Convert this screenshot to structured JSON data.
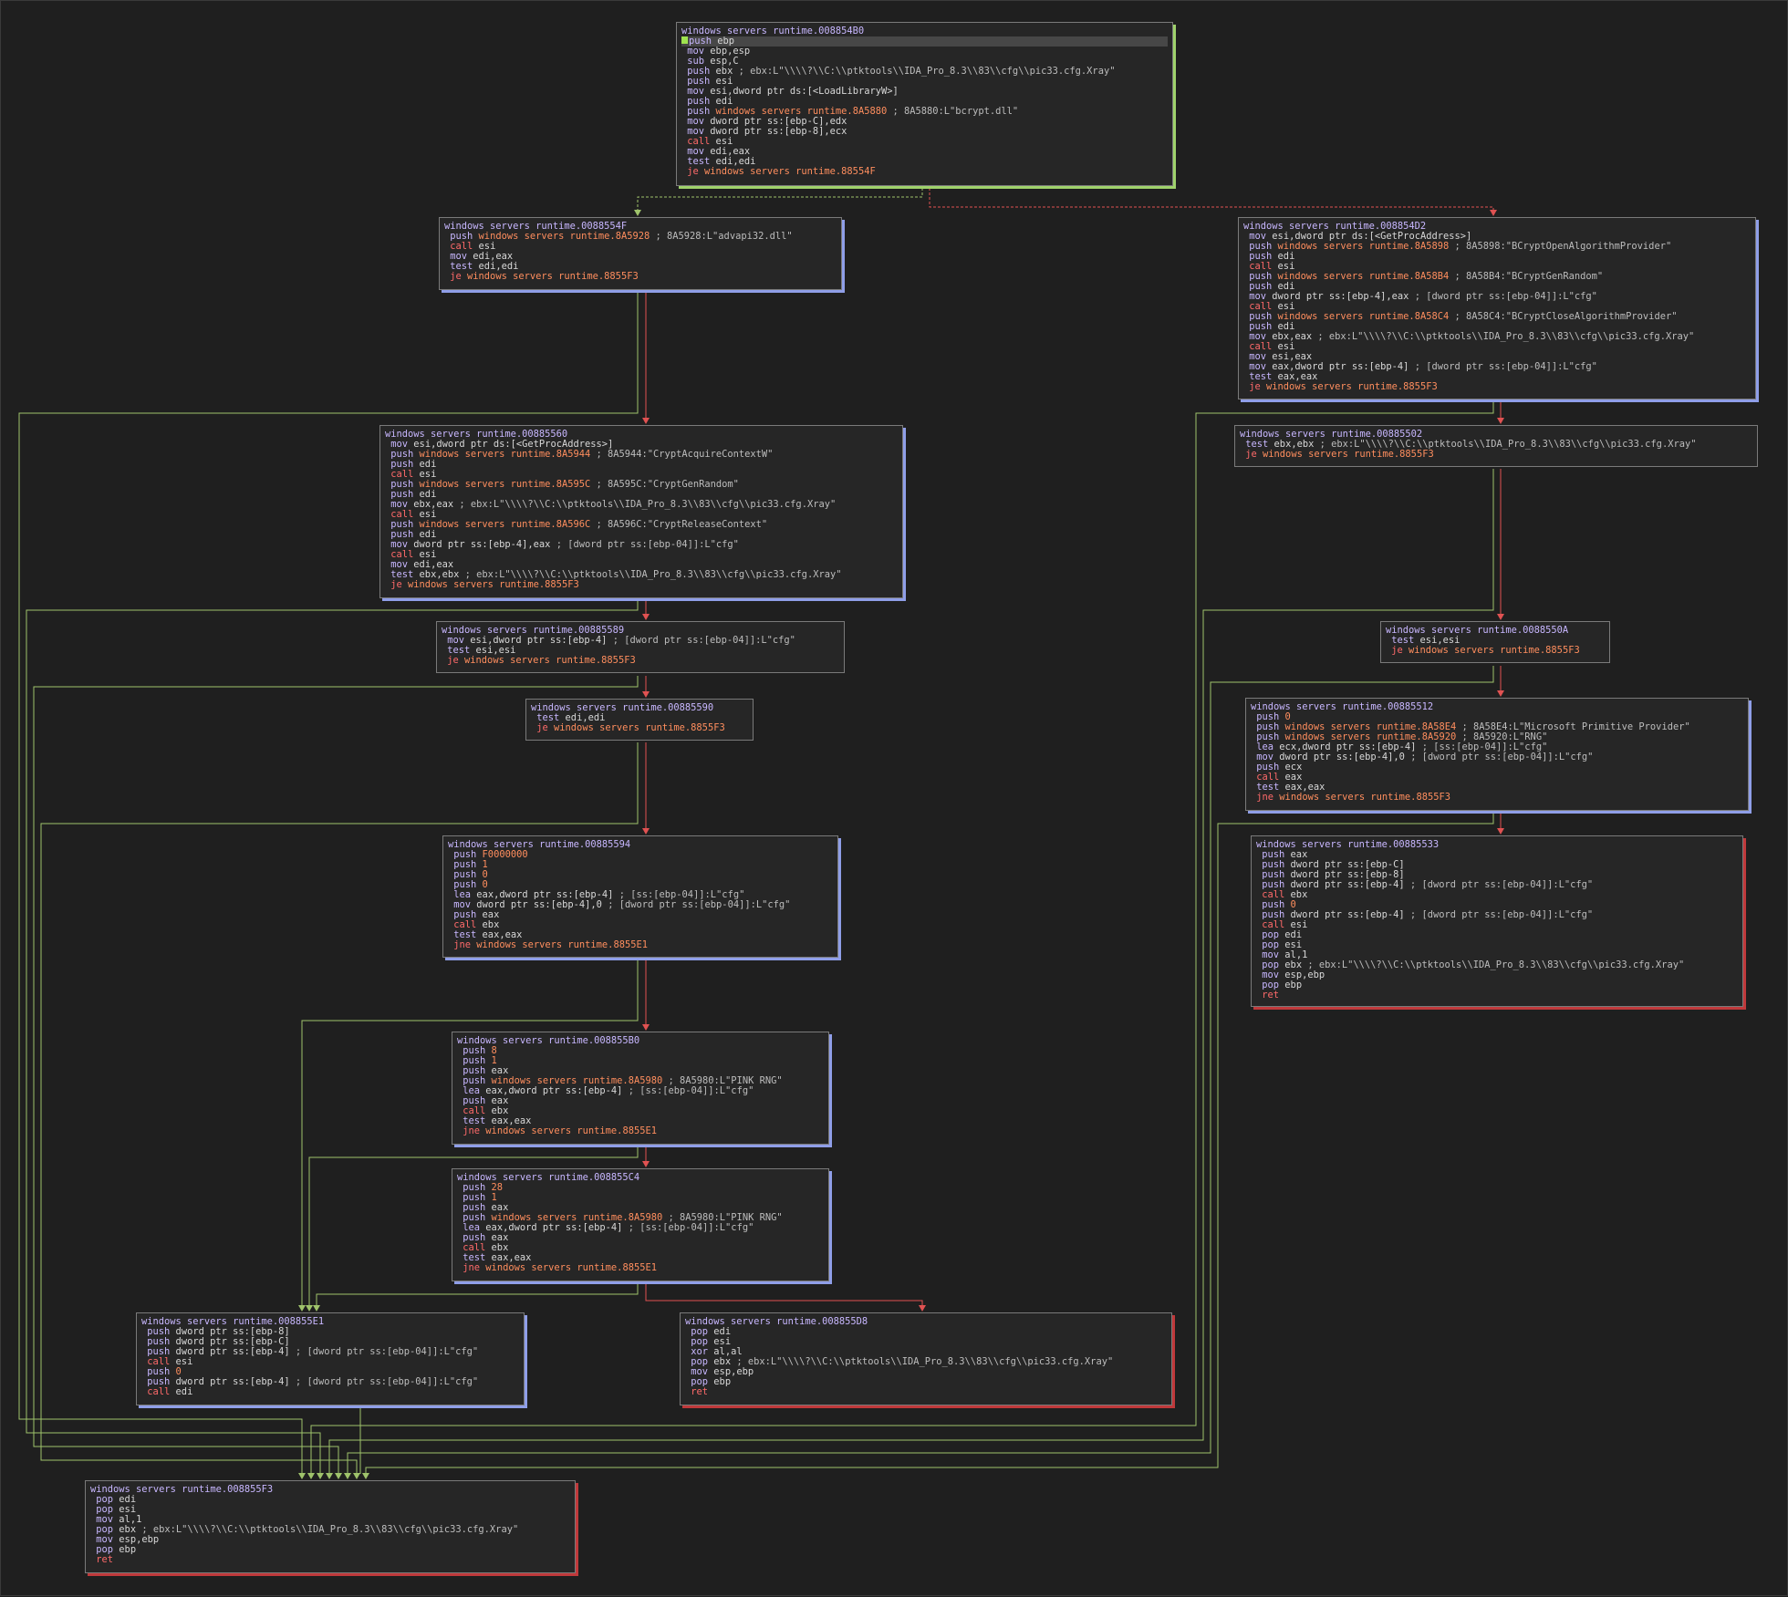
{
  "window": {
    "view": "graph",
    "label_prefix": "windows servers runtime."
  },
  "colors": {
    "background": "#1f1f1f",
    "block_bg": "#262626",
    "block_border": "#7a7a7a",
    "title": "#c8b7ff",
    "mnemonic": "#c8b7ff",
    "call_jump": "#ff6a6a",
    "address": "#ff8e5e",
    "edge_true": "#9fc36b",
    "edge_false": "#e05252",
    "shadow_entry": "#9fd26b",
    "shadow_normal": "#8f9ee8",
    "shadow_exit": "#c0393b"
  },
  "blocks": [
    {
      "id": "b854B0",
      "title": "windows servers runtime.008854B0",
      "kind": "entry",
      "lines": [
        {
          "t": "push ebp",
          "selected": true,
          "cursor": true
        },
        {
          "t": "mov ebp,esp"
        },
        {
          "t": "sub esp,C"
        },
        {
          "t": "push ebx ; ebx:L\"\\\\\\\\?\\\\C:\\\\ptktools\\\\IDA_Pro_8.3\\\\83\\\\cfg\\\\pic33.cfg.Xray\""
        },
        {
          "t": "push esi"
        },
        {
          "t": "mov esi,dword ptr ds:[<LoadLibraryW>]"
        },
        {
          "t": "push edi"
        },
        {
          "t": "push windows servers runtime.8A5880 ; 8A5880:L\"bcrypt.dll\""
        },
        {
          "t": "mov dword ptr ss:[ebp-C],edx"
        },
        {
          "t": "mov dword ptr ss:[ebp-8],ecx"
        },
        {
          "t": "call esi"
        },
        {
          "t": "mov edi,eax"
        },
        {
          "t": "test edi,edi"
        },
        {
          "t": "je windows servers runtime.88554F"
        }
      ]
    },
    {
      "id": "b8854F",
      "title": "windows servers runtime.0088554F",
      "kind": "normal",
      "lines": [
        {
          "t": "push windows servers runtime.8A5928 ; 8A5928:L\"advapi32.dll\""
        },
        {
          "t": "call esi"
        },
        {
          "t": "mov edi,eax"
        },
        {
          "t": "test edi,edi"
        },
        {
          "t": "je windows servers runtime.8855F3"
        }
      ]
    },
    {
      "id": "b854D2",
      "title": "windows servers runtime.008854D2",
      "kind": "normal",
      "lines": [
        {
          "t": "mov esi,dword ptr ds:[<GetProcAddress>]"
        },
        {
          "t": "push windows servers runtime.8A5898 ; 8A5898:\"BCryptOpenAlgorithmProvider\""
        },
        {
          "t": "push edi"
        },
        {
          "t": "call esi"
        },
        {
          "t": "push windows servers runtime.8A58B4 ; 8A58B4:\"BCryptGenRandom\""
        },
        {
          "t": "push edi"
        },
        {
          "t": "mov dword ptr ss:[ebp-4],eax ; [dword ptr ss:[ebp-04]]:L\"cfg\""
        },
        {
          "t": "call esi"
        },
        {
          "t": "push windows servers runtime.8A58C4 ; 8A58C4:\"BCryptCloseAlgorithmProvider\""
        },
        {
          "t": "push edi"
        },
        {
          "t": "mov ebx,eax ; ebx:L\"\\\\\\\\?\\\\C:\\\\ptktools\\\\IDA_Pro_8.3\\\\83\\\\cfg\\\\pic33.cfg.Xray\""
        },
        {
          "t": "call esi"
        },
        {
          "t": "mov esi,eax"
        },
        {
          "t": "mov eax,dword ptr ss:[ebp-4] ; [dword ptr ss:[ebp-04]]:L\"cfg\""
        },
        {
          "t": "test eax,eax"
        },
        {
          "t": "je windows servers runtime.8855F3"
        }
      ]
    },
    {
      "id": "b85560",
      "title": "windows servers runtime.00885560",
      "kind": "normal",
      "lines": [
        {
          "t": "mov esi,dword ptr ds:[<GetProcAddress>]"
        },
        {
          "t": "push windows servers runtime.8A5944 ; 8A5944:\"CryptAcquireContextW\""
        },
        {
          "t": "push edi"
        },
        {
          "t": "call esi"
        },
        {
          "t": "push windows servers runtime.8A595C ; 8A595C:\"CryptGenRandom\""
        },
        {
          "t": "push edi"
        },
        {
          "t": "mov ebx,eax ; ebx:L\"\\\\\\\\?\\\\C:\\\\ptktools\\\\IDA_Pro_8.3\\\\83\\\\cfg\\\\pic33.cfg.Xray\""
        },
        {
          "t": "call esi"
        },
        {
          "t": "push windows servers runtime.8A596C ; 8A596C:\"CryptReleaseContext\""
        },
        {
          "t": "push edi"
        },
        {
          "t": "mov dword ptr ss:[ebp-4],eax ; [dword ptr ss:[ebp-04]]:L\"cfg\""
        },
        {
          "t": "call esi"
        },
        {
          "t": "mov edi,eax"
        },
        {
          "t": "test ebx,ebx ; ebx:L\"\\\\\\\\?\\\\C:\\\\ptktools\\\\IDA_Pro_8.3\\\\83\\\\cfg\\\\pic33.cfg.Xray\""
        },
        {
          "t": "je windows servers runtime.8855F3"
        }
      ]
    },
    {
      "id": "b85502",
      "title": "windows servers runtime.00885502",
      "kind": "plain",
      "lines": [
        {
          "t": "test ebx,ebx ; ebx:L\"\\\\\\\\?\\\\C:\\\\ptktools\\\\IDA_Pro_8.3\\\\83\\\\cfg\\\\pic33.cfg.Xray\""
        },
        {
          "t": "je windows servers runtime.8855F3"
        }
      ]
    },
    {
      "id": "b85589",
      "title": "windows servers runtime.00885589",
      "kind": "plain",
      "lines": [
        {
          "t": "mov esi,dword ptr ss:[ebp-4] ; [dword ptr ss:[ebp-04]]:L\"cfg\""
        },
        {
          "t": "test esi,esi"
        },
        {
          "t": "je windows servers runtime.8855F3"
        }
      ]
    },
    {
      "id": "b8550A",
      "title": "windows servers runtime.0088550A",
      "kind": "plain",
      "lines": [
        {
          "t": "test esi,esi"
        },
        {
          "t": "je windows servers runtime.8855F3"
        }
      ]
    },
    {
      "id": "b85590",
      "title": "windows servers runtime.00885590",
      "kind": "plain",
      "lines": [
        {
          "t": "test edi,edi"
        },
        {
          "t": "je windows servers runtime.8855F3"
        }
      ]
    },
    {
      "id": "b85512",
      "title": "windows servers runtime.00885512",
      "kind": "normal",
      "lines": [
        {
          "t": "push 0"
        },
        {
          "t": "push windows servers runtime.8A58E4 ; 8A58E4:L\"Microsoft Primitive Provider\""
        },
        {
          "t": "push windows servers runtime.8A5920 ; 8A5920:L\"RNG\""
        },
        {
          "t": "lea ecx,dword ptr ss:[ebp-4] ; [ss:[ebp-04]]:L\"cfg\""
        },
        {
          "t": "mov dword ptr ss:[ebp-4],0 ; [dword ptr ss:[ebp-04]]:L\"cfg\""
        },
        {
          "t": "push ecx"
        },
        {
          "t": "call eax"
        },
        {
          "t": "test eax,eax"
        },
        {
          "t": "jne windows servers runtime.8855F3"
        }
      ]
    },
    {
      "id": "b85594",
      "title": "windows servers runtime.00885594",
      "kind": "normal",
      "lines": [
        {
          "t": "push F0000000"
        },
        {
          "t": "push 1"
        },
        {
          "t": "push 0"
        },
        {
          "t": "push 0"
        },
        {
          "t": "lea eax,dword ptr ss:[ebp-4] ; [ss:[ebp-04]]:L\"cfg\""
        },
        {
          "t": "mov dword ptr ss:[ebp-4],0 ; [dword ptr ss:[ebp-04]]:L\"cfg\""
        },
        {
          "t": "push eax"
        },
        {
          "t": "call ebx"
        },
        {
          "t": "test eax,eax"
        },
        {
          "t": "jne windows servers runtime.8855E1"
        }
      ]
    },
    {
      "id": "b85533",
      "title": "windows servers runtime.00885533",
      "kind": "exit",
      "lines": [
        {
          "t": "push eax"
        },
        {
          "t": "push dword ptr ss:[ebp-C]"
        },
        {
          "t": "push dword ptr ss:[ebp-8]"
        },
        {
          "t": "push dword ptr ss:[ebp-4] ; [dword ptr ss:[ebp-04]]:L\"cfg\""
        },
        {
          "t": "call ebx"
        },
        {
          "t": "push 0"
        },
        {
          "t": "push dword ptr ss:[ebp-4] ; [dword ptr ss:[ebp-04]]:L\"cfg\""
        },
        {
          "t": "call esi"
        },
        {
          "t": "pop edi"
        },
        {
          "t": "pop esi"
        },
        {
          "t": "mov al,1"
        },
        {
          "t": "pop ebx ; ebx:L\"\\\\\\\\?\\\\C:\\\\ptktools\\\\IDA_Pro_8.3\\\\83\\\\cfg\\\\pic33.cfg.Xray\""
        },
        {
          "t": "mov esp,ebp"
        },
        {
          "t": "pop ebp"
        },
        {
          "t": "ret"
        }
      ]
    },
    {
      "id": "b855B0",
      "title": "windows servers runtime.008855B0",
      "kind": "normal",
      "lines": [
        {
          "t": "push 8"
        },
        {
          "t": "push 1"
        },
        {
          "t": "push eax"
        },
        {
          "t": "push windows servers runtime.8A5980 ; 8A5980:L\"PINK RNG\""
        },
        {
          "t": "lea eax,dword ptr ss:[ebp-4] ; [ss:[ebp-04]]:L\"cfg\""
        },
        {
          "t": "push eax"
        },
        {
          "t": "call ebx"
        },
        {
          "t": "test eax,eax"
        },
        {
          "t": "jne windows servers runtime.8855E1"
        }
      ]
    },
    {
      "id": "b855C4",
      "title": "windows servers runtime.008855C4",
      "kind": "normal",
      "lines": [
        {
          "t": "push 28"
        },
        {
          "t": "push 1"
        },
        {
          "t": "push eax"
        },
        {
          "t": "push windows servers runtime.8A5980 ; 8A5980:L\"PINK RNG\""
        },
        {
          "t": "lea eax,dword ptr ss:[ebp-4] ; [ss:[ebp-04]]:L\"cfg\""
        },
        {
          "t": "push eax"
        },
        {
          "t": "call ebx"
        },
        {
          "t": "test eax,eax"
        },
        {
          "t": "jne windows servers runtime.8855E1"
        }
      ]
    },
    {
      "id": "b855E1",
      "title": "windows servers runtime.008855E1",
      "kind": "normal",
      "lines": [
        {
          "t": "push dword ptr ss:[ebp-8]"
        },
        {
          "t": "push dword ptr ss:[ebp-C]"
        },
        {
          "t": "push dword ptr ss:[ebp-4] ; [dword ptr ss:[ebp-04]]:L\"cfg\""
        },
        {
          "t": "call esi"
        },
        {
          "t": "push 0"
        },
        {
          "t": "push dword ptr ss:[ebp-4] ; [dword ptr ss:[ebp-04]]:L\"cfg\""
        },
        {
          "t": "call edi"
        }
      ]
    },
    {
      "id": "b855D8",
      "title": "windows servers runtime.008855D8",
      "kind": "exit",
      "lines": [
        {
          "t": "pop edi"
        },
        {
          "t": "pop esi"
        },
        {
          "t": "xor al,al"
        },
        {
          "t": "pop ebx ; ebx:L\"\\\\\\\\?\\\\C:\\\\ptktools\\\\IDA_Pro_8.3\\\\83\\\\cfg\\\\pic33.cfg.Xray\""
        },
        {
          "t": "mov esp,ebp"
        },
        {
          "t": "pop ebp"
        },
        {
          "t": "ret"
        }
      ]
    },
    {
      "id": "b855F3",
      "title": "windows servers runtime.008855F3",
      "kind": "exit",
      "lines": [
        {
          "t": "pop edi"
        },
        {
          "t": "pop esi"
        },
        {
          "t": "mov al,1"
        },
        {
          "t": "pop ebx ; ebx:L\"\\\\\\\\?\\\\C:\\\\ptktools\\\\IDA_Pro_8.3\\\\83\\\\cfg\\\\pic33.cfg.Xray\""
        },
        {
          "t": "mov esp,ebp"
        },
        {
          "t": "pop ebp"
        },
        {
          "t": "ret"
        }
      ]
    }
  ],
  "edges": [
    {
      "from": "b854B0",
      "to": "b8854F",
      "type": "true"
    },
    {
      "from": "b854B0",
      "to": "b854D2",
      "type": "false"
    },
    {
      "from": "b8854F",
      "to": "b855F3",
      "type": "true"
    },
    {
      "from": "b8854F",
      "to": "b85560",
      "type": "false"
    },
    {
      "from": "b854D2",
      "to": "b855F3",
      "type": "true"
    },
    {
      "from": "b854D2",
      "to": "b85502",
      "type": "false"
    },
    {
      "from": "b85560",
      "to": "b855F3",
      "type": "true"
    },
    {
      "from": "b85560",
      "to": "b85589",
      "type": "false"
    },
    {
      "from": "b85502",
      "to": "b855F3",
      "type": "true"
    },
    {
      "from": "b85502",
      "to": "b8550A",
      "type": "false"
    },
    {
      "from": "b85589",
      "to": "b855F3",
      "type": "true"
    },
    {
      "from": "b85589",
      "to": "b85590",
      "type": "false"
    },
    {
      "from": "b8550A",
      "to": "b855F3",
      "type": "true"
    },
    {
      "from": "b8550A",
      "to": "b85512",
      "type": "false"
    },
    {
      "from": "b85590",
      "to": "b855F3",
      "type": "true"
    },
    {
      "from": "b85590",
      "to": "b85594",
      "type": "false"
    },
    {
      "from": "b85512",
      "to": "b855F3",
      "type": "true"
    },
    {
      "from": "b85512",
      "to": "b85533",
      "type": "false"
    },
    {
      "from": "b85594",
      "to": "b855E1",
      "type": "true"
    },
    {
      "from": "b85594",
      "to": "b855B0",
      "type": "false"
    },
    {
      "from": "b855B0",
      "to": "b855E1",
      "type": "true"
    },
    {
      "from": "b855B0",
      "to": "b855C4",
      "type": "false"
    },
    {
      "from": "b855C4",
      "to": "b855E1",
      "type": "true"
    },
    {
      "from": "b855C4",
      "to": "b855D8",
      "type": "false"
    },
    {
      "from": "b855E1",
      "to": "b855F3",
      "type": "unconditional"
    }
  ]
}
